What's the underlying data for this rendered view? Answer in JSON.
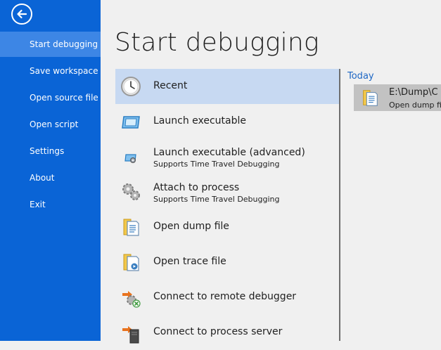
{
  "nav": {
    "back_icon": "arrow-left-icon",
    "items": [
      {
        "label": "Start debugging",
        "active": true
      },
      {
        "label": "Save workspace"
      },
      {
        "label": "Open source file"
      },
      {
        "label": "Open script"
      },
      {
        "label": "Settings"
      },
      {
        "label": "About"
      },
      {
        "label": "Exit"
      }
    ]
  },
  "main": {
    "title": "Start debugging",
    "actions": [
      {
        "label": "Recent",
        "icon": "clock-icon"
      },
      {
        "label": "Launch executable",
        "icon": "window-icon"
      },
      {
        "label": "Launch executable (advanced)",
        "sub": "Supports Time Travel Debugging",
        "icon": "window-settings-icon"
      },
      {
        "label": "Attach to process",
        "sub": "Supports Time Travel Debugging",
        "icon": "gears-icon"
      },
      {
        "label": "Open dump file",
        "icon": "dump-file-icon"
      },
      {
        "label": "Open trace file",
        "icon": "trace-file-icon"
      },
      {
        "label": "Connect to remote debugger",
        "icon": "remote-debugger-icon"
      },
      {
        "label": "Connect to process server",
        "icon": "process-server-icon"
      }
    ]
  },
  "recent": {
    "heading": "Today",
    "items": [
      {
        "path": "E:\\Dump\\C",
        "type": "Open dump fi",
        "icon": "dump-file-icon"
      }
    ]
  },
  "colors": {
    "nav_bg": "#0a64d6",
    "nav_active": "#3d86e5",
    "selected": "#c7d9f2",
    "heading_accent": "#1e67c4"
  }
}
